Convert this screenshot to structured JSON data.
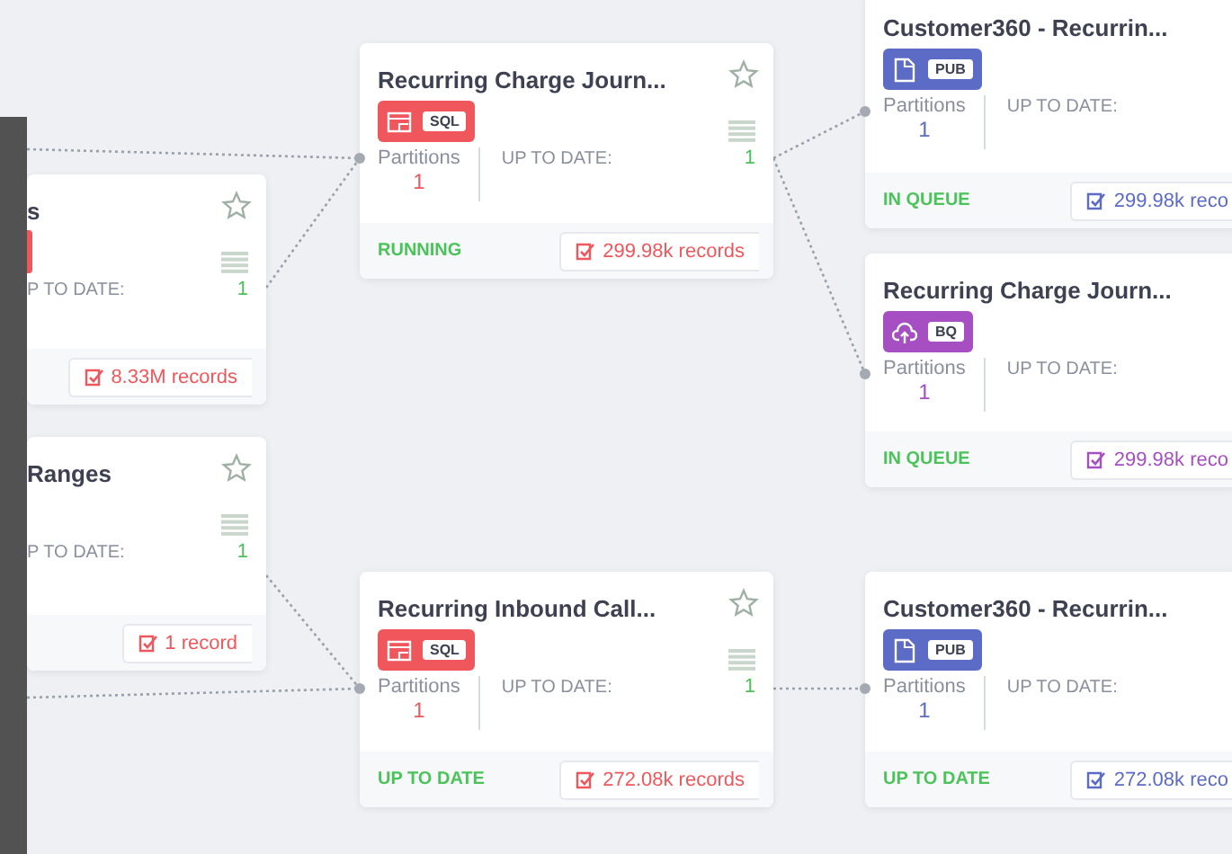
{
  "canvas": {
    "nodes": [
      {
        "kind": "partial",
        "title": "s",
        "badge": {
          "color": "#f0575c"
        },
        "up_to_date_label": "P TO DATE:",
        "up_to_date_count": "1",
        "records": "8.33M records",
        "color": "#f0575c"
      },
      {
        "kind": "partial",
        "title": "Ranges",
        "up_to_date_label": "P TO DATE:",
        "up_to_date_count": "1",
        "records": "1 record",
        "color": "#f0575c"
      },
      {
        "kind": "full",
        "title": "Recurring Charge Journ...",
        "badge": {
          "kind": "sql",
          "label": "SQL",
          "color": "#f0575c"
        },
        "partitions_label": "Partitions",
        "partitions": "1",
        "up_to_date_label": "UP TO DATE:",
        "up_to_date_count": "1",
        "status": "RUNNING",
        "records": "299.98k records"
      },
      {
        "kind": "full",
        "title": "Recurring Inbound Call...",
        "badge": {
          "kind": "sql",
          "label": "SQL",
          "color": "#f0575c"
        },
        "partitions_label": "Partitions",
        "partitions": "1",
        "up_to_date_label": "UP TO DATE:",
        "up_to_date_count": "1",
        "status": "UP TO DATE",
        "records": "272.08k records"
      },
      {
        "kind": "edge",
        "title": "Customer360 - Recurrin...",
        "badge": {
          "kind": "pub",
          "label": "PUB",
          "color": "#5b6bc6"
        },
        "partitions_label": "Partitions",
        "partitions": "1",
        "up_to_date_label": "UP TO DATE:",
        "status": "IN QUEUE",
        "records": "299.98k reco"
      },
      {
        "kind": "edge",
        "title": "Recurring Charge Journ...",
        "badge": {
          "kind": "bq",
          "label": "BQ",
          "color": "#a54fc2"
        },
        "partitions_label": "Partitions",
        "partitions": "1",
        "up_to_date_label": "UP TO DATE:",
        "status": "IN QUEUE",
        "records": "299.98k reco"
      },
      {
        "kind": "edge",
        "title": "Customer360 - Recurrin...",
        "badge": {
          "kind": "pub",
          "label": "PUB",
          "color": "#5b6bc6"
        },
        "partitions_label": "Partitions",
        "partitions": "1",
        "up_to_date_label": "UP TO DATE:",
        "status": "UP TO DATE",
        "records": "272.08k reco"
      }
    ]
  }
}
